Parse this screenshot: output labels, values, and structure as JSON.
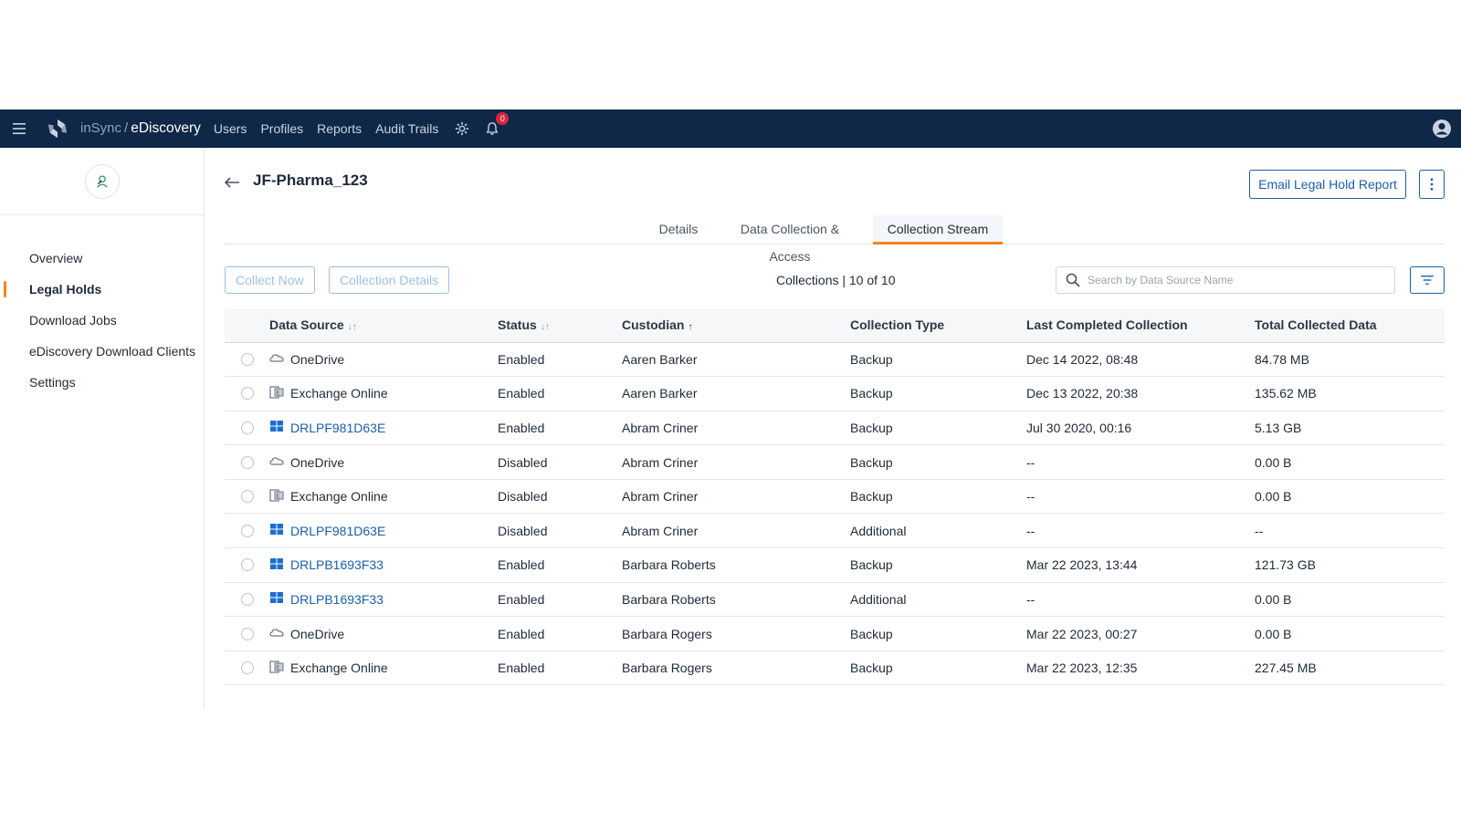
{
  "header": {
    "product": "inSync",
    "separator": "/",
    "app": "eDiscovery",
    "nav": [
      "Users",
      "Profiles",
      "Reports",
      "Audit Trails"
    ],
    "notification_count": "0"
  },
  "sidebar": {
    "items": [
      {
        "label": "Overview",
        "active": false
      },
      {
        "label": "Legal Holds",
        "active": true
      },
      {
        "label": "Download Jobs",
        "active": false
      },
      {
        "label": "eDiscovery Download Clients",
        "active": false
      },
      {
        "label": "Settings",
        "active": false
      }
    ]
  },
  "page": {
    "title": "JF-Pharma_123",
    "email_button": "Email Legal Hold Report",
    "tabs": [
      "Details",
      "Data Collection & Access",
      "Collection Stream"
    ],
    "active_tab": "Collection Stream",
    "collect_now": "Collect Now",
    "collection_details": "Collection Details",
    "count_label": "Collections | 10 of 10",
    "search_placeholder": "Search by Data Source Name"
  },
  "colors": {
    "topbar": "#0f2847",
    "accent": "#f5841f",
    "link": "#1b5fa8"
  },
  "table": {
    "columns": [
      "Data Source",
      "Status",
      "Custodian",
      "Collection Type",
      "Last Completed Collection",
      "Total Collected Data"
    ],
    "rows": [
      {
        "icon": "onedrive-icon",
        "source": "OneDrive",
        "link": false,
        "status": "Enabled",
        "custodian": "Aaren Barker",
        "type": "Backup",
        "last": "Dec 14 2022, 08:48",
        "total": "84.78 MB"
      },
      {
        "icon": "exchange-icon",
        "source": "Exchange Online",
        "link": false,
        "status": "Enabled",
        "custodian": "Aaren Barker",
        "type": "Backup",
        "last": "Dec 13 2022, 20:38",
        "total": "135.62 MB"
      },
      {
        "icon": "windows-icon",
        "source": "DRLPF981D63E",
        "link": true,
        "status": "Enabled",
        "custodian": "Abram Criner",
        "type": "Backup",
        "last": "Jul 30 2020, 00:16",
        "total": "5.13 GB"
      },
      {
        "icon": "onedrive-icon",
        "source": "OneDrive",
        "link": false,
        "status": "Disabled",
        "custodian": "Abram Criner",
        "type": "Backup",
        "last": "--",
        "total": "0.00 B"
      },
      {
        "icon": "exchange-icon",
        "source": "Exchange Online",
        "link": false,
        "status": "Disabled",
        "custodian": "Abram Criner",
        "type": "Backup",
        "last": "--",
        "total": "0.00 B"
      },
      {
        "icon": "windows-icon",
        "source": "DRLPF981D63E",
        "link": true,
        "status": "Disabled",
        "custodian": "Abram Criner",
        "type": "Additional",
        "last": "--",
        "total": "--"
      },
      {
        "icon": "windows-icon",
        "source": "DRLPB1693F33",
        "link": true,
        "status": "Enabled",
        "custodian": "Barbara Roberts",
        "type": "Backup",
        "last": "Mar 22 2023, 13:44",
        "total": "121.73 GB"
      },
      {
        "icon": "windows-icon",
        "source": "DRLPB1693F33",
        "link": true,
        "status": "Enabled",
        "custodian": "Barbara Roberts",
        "type": "Additional",
        "last": "--",
        "total": "0.00 B"
      },
      {
        "icon": "onedrive-icon",
        "source": "OneDrive",
        "link": false,
        "status": "Enabled",
        "custodian": "Barbara Rogers",
        "type": "Backup",
        "last": "Mar 22 2023, 00:27",
        "total": "0.00 B"
      },
      {
        "icon": "exchange-icon",
        "source": "Exchange Online",
        "link": false,
        "status": "Enabled",
        "custodian": "Barbara Rogers",
        "type": "Backup",
        "last": "Mar 22 2023, 12:35",
        "total": "227.45 MB"
      }
    ]
  }
}
